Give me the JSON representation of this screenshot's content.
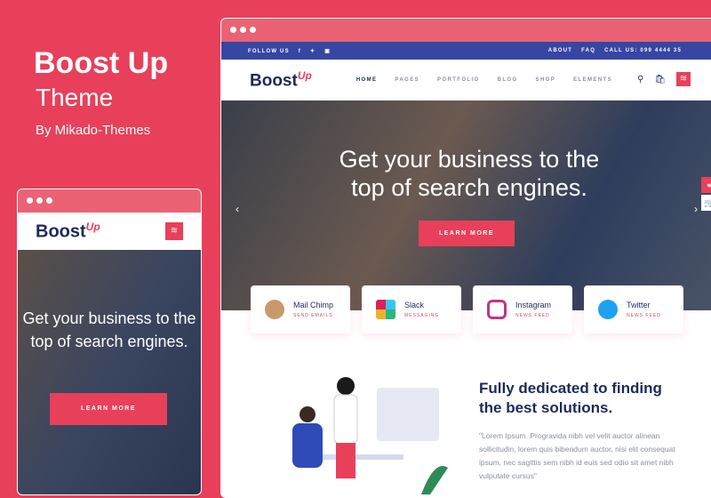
{
  "promo": {
    "title": "Boost Up",
    "subtitle": "Theme",
    "author": "By Mikado-Themes"
  },
  "desktop": {
    "topbar": {
      "follow": "FOLLOW US",
      "social": [
        "f",
        "t",
        "ig"
      ],
      "links": [
        "ABOUT",
        "FAQ",
        "CALL US: 099 4444 35"
      ]
    },
    "logo": "Boost",
    "logo_mark": "Up",
    "menu": [
      "HOME",
      "PAGES",
      "PORTFOLIO",
      "BLOG",
      "SHOP",
      "ELEMENTS"
    ],
    "hero": {
      "heading_line1": "Get your business to the",
      "heading_line2": "top of search engines.",
      "button": "LEARN MORE"
    },
    "cards": [
      {
        "title": "Mail Chimp",
        "sub": "SEND EMAILS",
        "color": "#3a6fb0"
      },
      {
        "title": "Slack",
        "sub": "MESSAGING",
        "color": "#36c5ab"
      },
      {
        "title": "Instagram",
        "sub": "NEWS FEED",
        "color": "#c13584"
      },
      {
        "title": "Twitter",
        "sub": "NEWS FEED",
        "color": "#1da1f2"
      }
    ],
    "section": {
      "heading": "Fully dedicated to finding the best solutions.",
      "text": "\"Lorem Ipsum. Progravida nibh vel velit auctor alinean sollicitudin, lorem quis bibendum auctor, nisi elit consequat ipsum, nec sagittis sem nibh id euis sed odio sit amet nibh vulputate cursus\""
    }
  },
  "mobile": {
    "logo": "Boost",
    "logo_mark": "Up",
    "hero": {
      "heading": "Get your business to the top of search engines.",
      "button": "LEARN MORE"
    }
  },
  "colors": {
    "accent": "#e8405a",
    "navy": "#1c2a5a",
    "topbar": "#3646a3"
  }
}
